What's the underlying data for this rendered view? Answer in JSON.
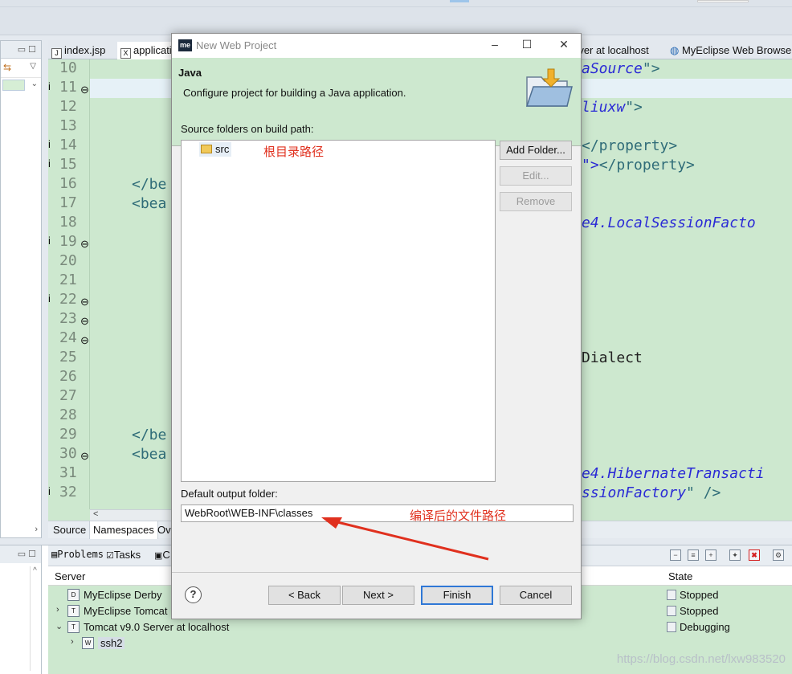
{
  "dialog": {
    "title": "New Web Project",
    "logo_text": "me",
    "minimize_glyph": "–",
    "maximize_glyph": "☐",
    "close_glyph": "✕",
    "section_title": "Java",
    "description": "Configure project for building a Java application.",
    "source_folders_label": "Source folders on build path:",
    "source_folders": [
      {
        "name": "src"
      }
    ],
    "annotation_root": "根目录路径",
    "buttons": {
      "add_folder": "Add Folder...",
      "edit": "Edit...",
      "remove": "Remove"
    },
    "output_folder_label": "Default output folder:",
    "output_folder_value": "WebRoot\\WEB-INF\\classes",
    "annotation_output": "编译后的文件路径",
    "footer_buttons": {
      "help": "?",
      "back": "< Back",
      "next": "Next >",
      "finish": "Finish",
      "cancel": "Cancel"
    }
  },
  "editor": {
    "tabs": [
      {
        "label": "index.jsp",
        "icon": "jsp-file-icon"
      },
      {
        "label": "applicati",
        "icon": "xml-file-icon"
      },
      {
        "label": "rver at localhost",
        "icon": ""
      },
      {
        "label": "MyEclipse Web Browse",
        "icon": "browser-icon"
      }
    ],
    "line_numbers": [
      "10",
      "11",
      "12",
      "13",
      "14",
      "15",
      "16",
      "17",
      "18",
      "19",
      "20",
      "21",
      "22",
      "23",
      "24",
      "25",
      "26",
      "27",
      "28",
      "29",
      "30",
      "31",
      "32"
    ],
    "info_lines": [
      "11",
      "14",
      "15",
      "19",
      "22",
      "32"
    ],
    "fold_lines": [
      "11",
      "19",
      "22",
      "23",
      "24",
      "30"
    ],
    "code_fragments": [
      {
        "row": 0,
        "col": "right",
        "parts": [
          {
            "t": "aSource",
            "c": "str"
          },
          {
            "t": "\">",
            "c": "tag"
          }
        ]
      },
      {
        "row": 2,
        "col": "right",
        "parts": [
          {
            "t": "liuxw",
            "c": "str"
          },
          {
            "t": "\">",
            "c": "tag"
          }
        ]
      },
      {
        "row": 4,
        "col": "right",
        "parts": [
          {
            "t": "</property>",
            "c": "tag"
          }
        ]
      },
      {
        "row": 5,
        "col": "right",
        "parts": [
          {
            "t": "\">",
            "c": "str"
          },
          {
            "t": "</property>",
            "c": "tag"
          }
        ]
      },
      {
        "row": 6,
        "col": "left",
        "parts": [
          {
            "t": "</be",
            "c": "tag"
          }
        ]
      },
      {
        "row": 7,
        "col": "left",
        "parts": [
          {
            "t": "<bea",
            "c": "tag"
          }
        ]
      },
      {
        "row": 8,
        "col": "right",
        "parts": [
          {
            "t": "e4.LocalSessionFacto",
            "c": "str"
          }
        ]
      },
      {
        "row": 15,
        "col": "right",
        "parts": [
          {
            "t": "Dialect",
            "c": "plain"
          }
        ]
      },
      {
        "row": 19,
        "col": "left",
        "parts": [
          {
            "t": "</be",
            "c": "tag"
          }
        ]
      },
      {
        "row": 20,
        "col": "left",
        "parts": [
          {
            "t": "<bea",
            "c": "tag"
          }
        ]
      },
      {
        "row": 21,
        "col": "right",
        "parts": [
          {
            "t": "e4.HibernateTransacti",
            "c": "str"
          }
        ]
      },
      {
        "row": 22,
        "col": "right",
        "parts": [
          {
            "t": "ssionFactory",
            "c": "str"
          },
          {
            "t": "\" />",
            "c": "tag"
          }
        ]
      }
    ],
    "bottom_tabs": [
      "Source",
      "Namespaces",
      "Ov"
    ]
  },
  "bottom": {
    "tabs": [
      {
        "label": "Problems",
        "icon": "problems-icon"
      },
      {
        "label": "Tasks",
        "icon": "tasks-icon"
      },
      {
        "label": "C",
        "icon": "console-icon"
      }
    ],
    "columns": {
      "server": "Server",
      "state": "State"
    },
    "servers": [
      {
        "name": "MyEclipse Derby",
        "state": "Stopped",
        "icon": "derby-icon",
        "expandable": false
      },
      {
        "name": "MyEclipse Tomcat",
        "state": "Stopped",
        "icon": "tomcat-icon",
        "expandable": true
      },
      {
        "name": "Tomcat v9.0 Server at localhost",
        "state": "Debugging",
        "icon": "tomcat-icon",
        "expanded": true
      },
      {
        "name": "ssh2",
        "state": "",
        "icon": "web-project-icon",
        "child": true
      }
    ]
  },
  "watermark": "https://blog.csdn.net/lxw983520",
  "colors": {
    "editor_bg": "#cde8cf",
    "annotation_red": "#e0301e",
    "default_button_border": "#2f78d6"
  }
}
